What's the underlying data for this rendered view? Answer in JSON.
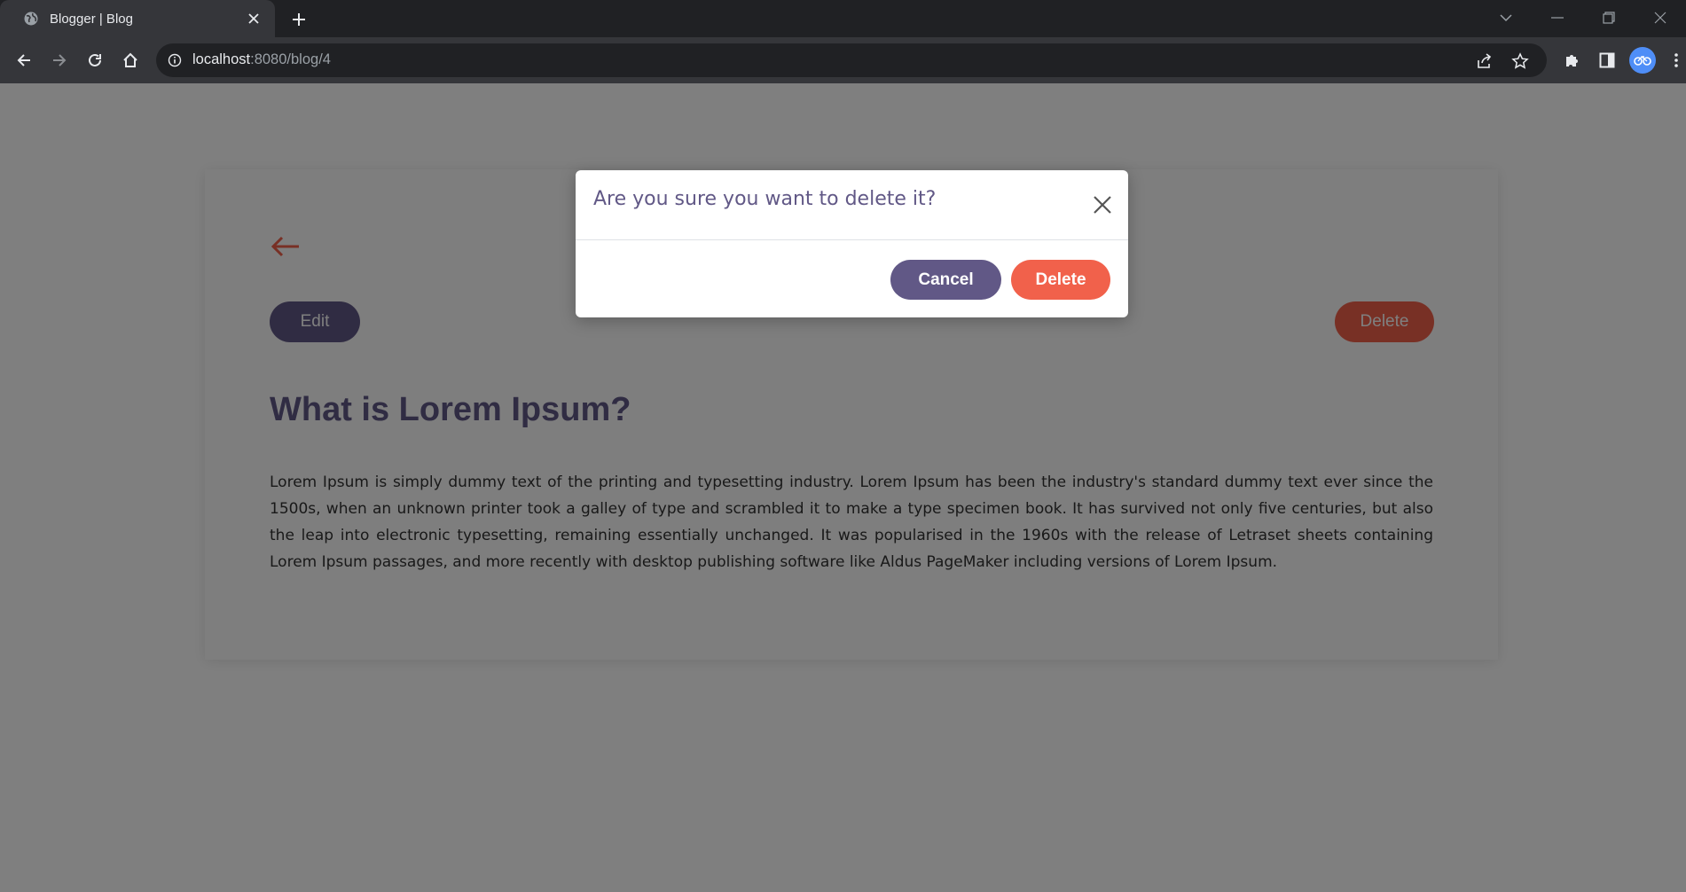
{
  "browser": {
    "tab": {
      "title": "Blogger | Blog",
      "favicon": "globe-icon",
      "close_icon": "close-icon"
    },
    "new_tab_icon": "plus-icon",
    "window_controls": [
      "chevron-down-icon",
      "minimize-icon",
      "restore-icon",
      "close-icon"
    ],
    "nav": [
      "back-arrow-icon",
      "forward-arrow-icon",
      "reload-icon",
      "home-icon"
    ],
    "address": {
      "host": "localhost",
      "path": ":8080/blog/4",
      "info_icon": "info-icon"
    },
    "omnibox_icons": [
      "share-icon",
      "star-icon"
    ],
    "toolbar_icons": [
      "extensions-puzzle-icon",
      "side-panel-icon",
      "profile-avatar",
      "kebab-menu-icon"
    ]
  },
  "page": {
    "back_icon": "left-arrow-icon",
    "edit_label": "Edit",
    "delete_label": "Delete",
    "title": "What is Lorem Ipsum?",
    "body": "Lorem Ipsum is simply dummy text of the printing and typesetting industry. Lorem Ipsum has been the industry's standard dummy text ever since the 1500s, when an unknown printer took a galley of type and scrambled it to make a type specimen book. It has survived not only five centuries, but also the leap into electronic typesetting, remaining essentially unchanged. It was popularised in the 1960s with the release of Letraset sheets containing Lorem Ipsum passages, and more recently with desktop publishing software like Aldus PageMaker including versions of Lorem Ipsum."
  },
  "modal": {
    "title": "Are you sure you want to delete it?",
    "close_icon": "close-icon",
    "cancel_label": "Cancel",
    "delete_label": "Delete"
  },
  "colors": {
    "primary": "#615886",
    "danger": "#f1614b",
    "chrome_dark": "#202124",
    "chrome_toolbar": "#35363a",
    "overlay": "rgba(0,0,0,0.5)"
  }
}
